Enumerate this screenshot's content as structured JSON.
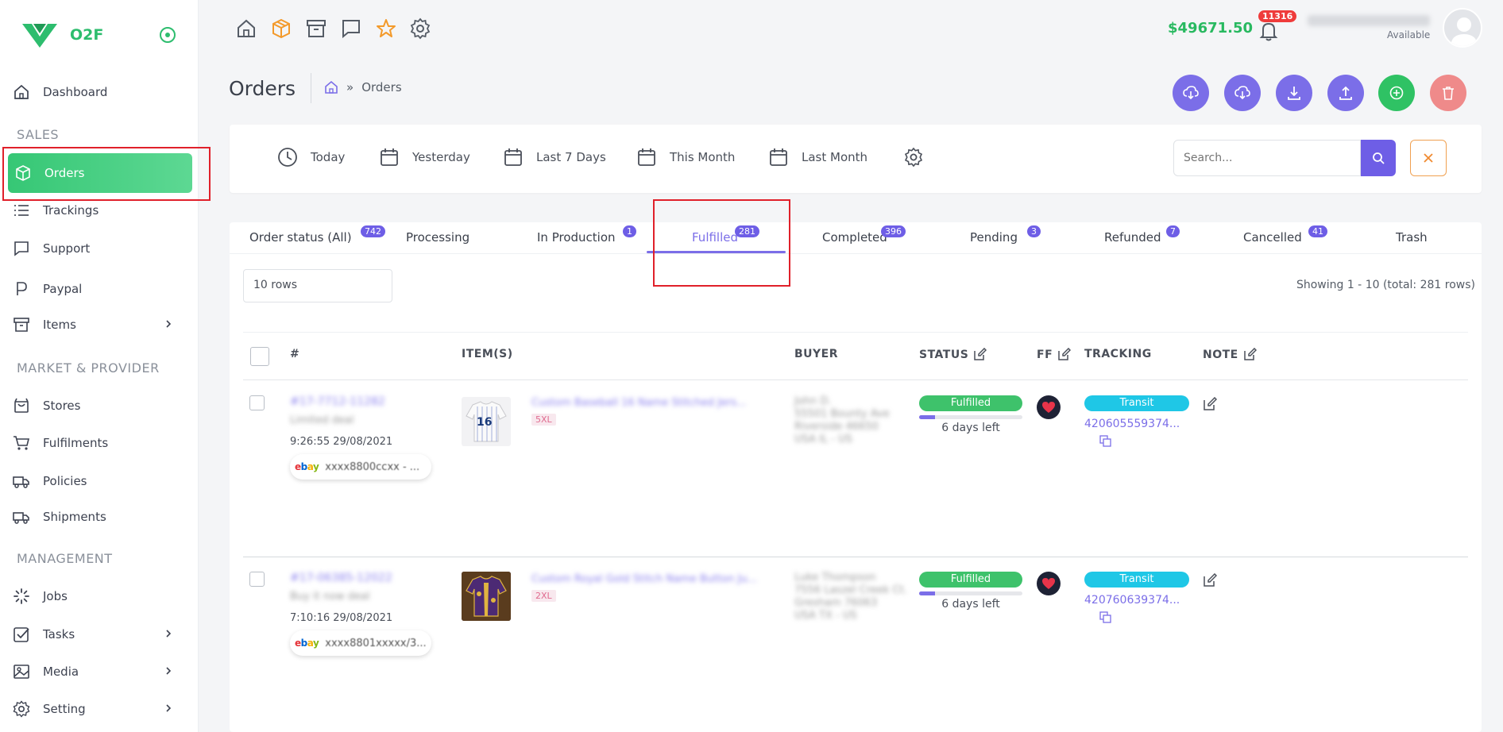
{
  "app": {
    "name": "O2F"
  },
  "sidebar": {
    "sections": {
      "sales": "SALES",
      "market": "MARKET & PROVIDER",
      "management": "MANAGEMENT"
    },
    "items": {
      "dashboard": "Dashboard",
      "orders": "Orders",
      "trackings": "Trackings",
      "support": "Support",
      "paypal": "Paypal",
      "items": "Items",
      "stores": "Stores",
      "fulfilments": "Fulfilments",
      "policies": "Policies",
      "shipments": "Shipments",
      "jobs": "Jobs",
      "tasks": "Tasks",
      "media": "Media",
      "setting": "Setting"
    }
  },
  "topbar": {
    "balance": "$49671.50",
    "notifications": "11316",
    "user_status": "Available"
  },
  "page": {
    "title": "Orders",
    "breadcrumb_sep": "»",
    "breadcrumb_current": "Orders"
  },
  "filters": {
    "today": "Today",
    "yesterday": "Yesterday",
    "last7": "Last 7 Days",
    "this_month": "This Month",
    "last_month": "Last Month",
    "search_placeholder": "Search..."
  },
  "tabs": {
    "all": {
      "label": "Order status (All)",
      "count": "742"
    },
    "processing": {
      "label": "Processing"
    },
    "in_production": {
      "label": "In Production",
      "count": "1"
    },
    "fulfilled": {
      "label": "Fulfilled",
      "count": "281"
    },
    "completed": {
      "label": "Completed",
      "count": "396"
    },
    "pending": {
      "label": "Pending",
      "count": "3"
    },
    "refunded": {
      "label": "Refunded",
      "count": "7"
    },
    "cancelled": {
      "label": "Cancelled",
      "count": "41"
    },
    "trash": {
      "label": "Trash"
    }
  },
  "table": {
    "rows_select": "10 rows",
    "showing": "Showing 1 - 10 (total: 281 rows)",
    "headers": {
      "num": "#",
      "items": "ITEM(S)",
      "buyer": "BUYER",
      "status": "STATUS",
      "ff": "FF",
      "tracking": "TRACKING",
      "note": "NOTE"
    },
    "rows": [
      {
        "order_id": "#17-7712-11282",
        "sub": "Limited deal",
        "time": "9:26:55 29/08/2021",
        "store": "xxxx8800ccxx - ...",
        "item_title": "Custom Baseball 16 Name Stitched Jers...",
        "size": "5XL",
        "buyer_1": "John D.",
        "buyer_2": "55501 Bounty Ave",
        "buyer_3": "Riverside 46650",
        "buyer_4": "USA IL - US",
        "status": "Fulfilled",
        "progress": 0.15,
        "days_left": "6 days left",
        "transit": "Transit",
        "tracking": "420605559374..."
      },
      {
        "order_id": "#17-06385-12022",
        "sub": "Buy it now deal",
        "time": "7:10:16 29/08/2021",
        "store": "xxxx8801xxxxx/3...",
        "item_title": "Custom Royal Gold Stitch Name Button Ju...",
        "size": "2XL",
        "buyer_1": "Luke Thompson",
        "buyer_2": "7556 Laszel Creek Ct.",
        "buyer_3": "Gresham 76063",
        "buyer_4": "USA TX - US",
        "status": "Fulfilled",
        "progress": 0.15,
        "days_left": "6 days left",
        "transit": "Transit",
        "tracking": "420760639374..."
      }
    ]
  },
  "colors": {
    "brand_green": "#2dbd6e",
    "accent_purple": "#6e5ee6",
    "danger": "#e0202a",
    "transit": "#1fc7e6"
  }
}
